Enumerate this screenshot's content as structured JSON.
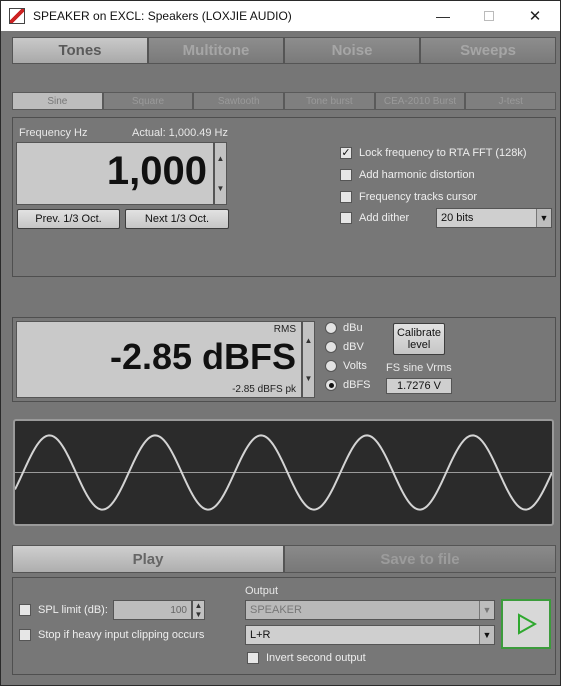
{
  "window": {
    "title": "SPEAKER on EXCL: Speakers (LOXJIE AUDIO)",
    "minimize_glyph": "—",
    "close_glyph": "✕"
  },
  "main_tabs": [
    {
      "label": "Tones",
      "active": true
    },
    {
      "label": "Multitone",
      "active": false
    },
    {
      "label": "Noise",
      "active": false
    },
    {
      "label": "Sweeps",
      "active": false
    }
  ],
  "sub_tabs": [
    {
      "label": "Sine",
      "active": true
    },
    {
      "label": "Square",
      "active": false
    },
    {
      "label": "Sawtooth",
      "active": false
    },
    {
      "label": "Tone burst",
      "active": false
    },
    {
      "label": "CEA-2010 Burst",
      "active": false
    },
    {
      "label": "J-test",
      "active": false
    }
  ],
  "frequency": {
    "label": "Frequency Hz",
    "actual": "Actual: 1,000.49 Hz",
    "value": "1,000",
    "prev_button": "Prev. 1/3 Oct.",
    "next_button": "Next 1/3 Oct."
  },
  "options": {
    "lock_fft": {
      "label": "Lock frequency to RTA FFT (128k)",
      "checked": true
    },
    "harmonic": {
      "label": "Add harmonic distortion",
      "checked": false
    },
    "tracks_cursor": {
      "label": "Frequency tracks cursor",
      "checked": false
    },
    "dither": {
      "label": "Add dither",
      "checked": false,
      "bits": "20 bits"
    }
  },
  "level": {
    "rms_label": "RMS",
    "value": "-2.85 dBFS",
    "peak": "-2.85 dBFS pk",
    "units": [
      {
        "label": "dBu",
        "selected": false
      },
      {
        "label": "dBV",
        "selected": false
      },
      {
        "label": "Volts",
        "selected": false
      },
      {
        "label": "dBFS",
        "selected": true
      }
    ],
    "calibrate_button": "Calibrate level",
    "fs_label": "FS sine Vrms",
    "fs_value": "1.7276 V"
  },
  "scope": {
    "cycles": 5,
    "amplitude": 0.72
  },
  "bottom_tabs": {
    "play": "Play",
    "save": "Save to file"
  },
  "bottom": {
    "spl_limit": {
      "label": "SPL limit (dB):",
      "checked": false,
      "value": "100"
    },
    "stop_clipping": {
      "label": "Stop if heavy input clipping occurs",
      "checked": false
    },
    "output_label": "Output",
    "output_device": "SPEAKER",
    "output_channels": "L+R",
    "invert": {
      "label": "Invert second output",
      "checked": false
    }
  },
  "colors": {
    "accent_play": "#2fa82f",
    "trace": "#d4d4d4"
  }
}
